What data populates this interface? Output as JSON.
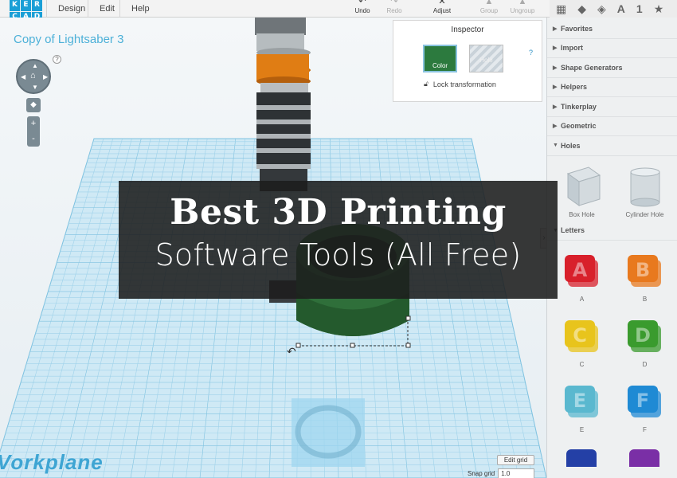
{
  "app": {
    "logo_letters": [
      "K",
      "E",
      "R",
      "C",
      "A",
      "D"
    ],
    "menu": [
      "Design",
      "Edit",
      "Help"
    ]
  },
  "toolbar": {
    "undo": "Undo",
    "redo": "Redo",
    "adjust": "Adjust",
    "group": "Group",
    "ungroup": "Ungroup"
  },
  "viewport": {
    "doc_title": "Copy of Lightsaber 3",
    "help": "?",
    "zoom_in": "+",
    "zoom_out": "-",
    "workplane_label": "Vorkplane",
    "edit_grid": "Edit grid",
    "snap_grid_label": "Snap grid",
    "snap_grid_value": "1.0"
  },
  "inspector": {
    "title": "Inspector",
    "color_label": "Color",
    "hole_label": "Hole",
    "help": "?",
    "lock_label": "Lock transformation"
  },
  "sidebar": {
    "categories": [
      "Favorites",
      "Import",
      "Shape Generators",
      "Helpers",
      "Tinkerplay",
      "Geometric",
      "Holes"
    ],
    "holes": [
      "Box Hole",
      "Cylinder Hole"
    ],
    "letters_title": "Letters",
    "letters": [
      "A",
      "B",
      "C",
      "D",
      "E",
      "F"
    ],
    "letter_colors": [
      "#d8202b",
      "#e8791e",
      "#e8c41c",
      "#3a9b2e",
      "#5ab8cf",
      "#1f8ad4"
    ],
    "partial_letter_colors": [
      "#2440a6",
      "#7a2fa6"
    ]
  },
  "banner": {
    "title": "Best 3D Printing",
    "subtitle": "Software Tools (All Free)"
  }
}
